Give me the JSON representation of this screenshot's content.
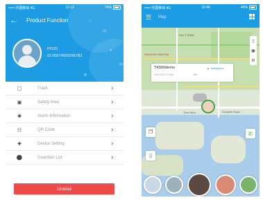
{
  "left": {
    "status": {
      "carrier": "••••• 中国移动 4G",
      "time": "12:12",
      "battery": "74%"
    },
    "title": "Product Function",
    "device": {
      "name": "PIS20",
      "id": "ID:358740052967B2"
    },
    "menu": [
      {
        "label": "Track",
        "icon": "track-icon"
      },
      {
        "label": "Safety Area",
        "icon": "safety-area-icon"
      },
      {
        "label": "Alarm Information",
        "icon": "alarm-icon"
      },
      {
        "label": "QR Code",
        "icon": "qr-code-icon"
      },
      {
        "label": "Device Setting",
        "icon": "wrench-icon"
      },
      {
        "label": "Guardian List",
        "icon": "shield-icon"
      }
    ],
    "unbind_label": "Unbind",
    "colors": {
      "header": "#1d9be3",
      "unbind": "#ef4a4a"
    }
  },
  "right": {
    "status": {
      "carrier": "••••• 中国移动 4G",
      "time": "15:46",
      "battery": "44%"
    },
    "title": "Map",
    "device_name": "TK500demo",
    "navigation_label": "Navigation",
    "timestamp": "2016-05-27 13:56",
    "location_source": "LBS",
    "map_labels": {
      "label_1": "Nou T Road",
      "label_2": "Shenzhen West Rai",
      "label_3": "Tuen Mun",
      "label_4": "Dongbin Road"
    }
  }
}
